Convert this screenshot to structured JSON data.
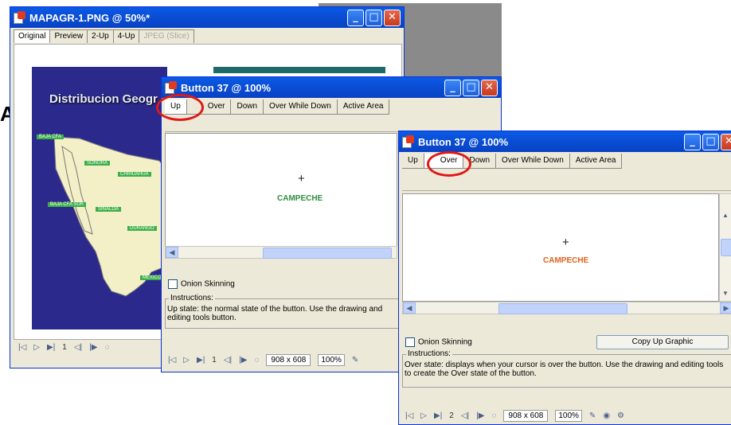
{
  "window1": {
    "title": "MAPAGR-1.PNG @ 50%*",
    "tabs": [
      {
        "label": "Original",
        "selected": true
      },
      {
        "label": "Preview"
      },
      {
        "label": "2-Up"
      },
      {
        "label": "4-Up"
      },
      {
        "label": "JPEG (Slice)",
        "disabled": true
      }
    ],
    "map_title": "Distribucion Geogr",
    "map_labels": [
      "BAJA CFA",
      "SONORA",
      "CHIHUAHUA",
      "BAJA CFA SUR",
      "SINALOA",
      "DURANGO",
      "MEXICO"
    ],
    "footer": {
      "page": "1"
    }
  },
  "window2": {
    "title": "Button 37 @ 100%",
    "tabs": [
      "Up",
      "Over",
      "Down",
      "Over While Down",
      "Active Area"
    ],
    "canvas_label": "CAMPECHE",
    "onion_label": "Onion Skinning",
    "onion_underline": "O",
    "instructions_label": "Instructions:",
    "instructions_text": "Up state: the normal state of the button. Use the drawing and editing tools button.",
    "footer": {
      "page": "1",
      "dims": "908 x 608",
      "zoom": "100%"
    }
  },
  "window3": {
    "title": "Button 37 @ 100%",
    "tabs": [
      "Up",
      "Over",
      "Down",
      "Over While Down",
      "Active Area"
    ],
    "canvas_label": "CAMPECHE",
    "onion_label": "Onion Skinning",
    "copy_button": "Copy Up Graphic",
    "instructions_label": "Instructions:",
    "instructions_text": "Over state: displays when your cursor is over the button. Use the drawing and editing tools to create the Over state of the button.",
    "footer": {
      "page": "2",
      "dims": "908 x 608",
      "zoom": "100%"
    }
  },
  "colors": {
    "titlebar": "#0a4fd6",
    "highlight_ellipse": "#e01818",
    "map_background": "#2b2a8c",
    "up_label": "#2f8f3f",
    "over_label": "#e0601a"
  },
  "icons": [
    "first-frame-icon",
    "play-icon",
    "last-frame-icon",
    "prev-frame-icon",
    "next-frame-icon",
    "loop-icon",
    "pencil-icon",
    "paint-icon",
    "tool-icon"
  ]
}
